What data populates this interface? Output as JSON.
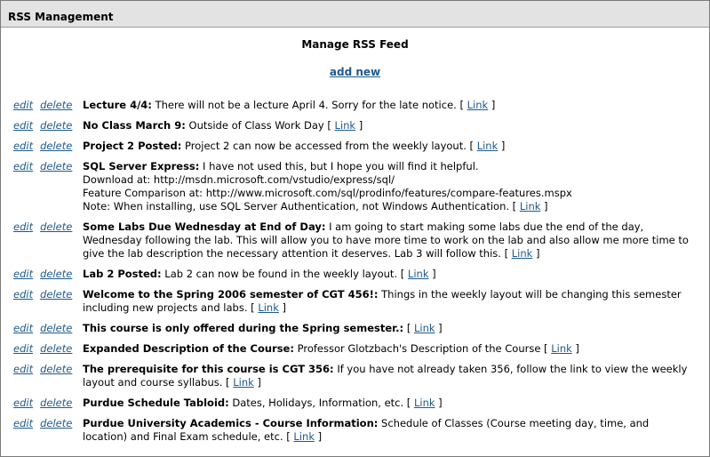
{
  "header": {
    "title": "RSS Management"
  },
  "page": {
    "heading": "Manage RSS Feed",
    "add_new_label": "add new"
  },
  "row_actions": {
    "edit_label": "edit",
    "delete_label": "delete"
  },
  "link_label": "Link",
  "feeds": [
    {
      "title": "Lecture 4/4:",
      "desc": "There will not be a lecture April 4. Sorry for the late notice.",
      "extra": []
    },
    {
      "title": "No Class March 9:",
      "desc": "Outside of Class Work Day",
      "extra": []
    },
    {
      "title": "Project 2 Posted:",
      "desc": "Project 2 can now be accessed from the weekly layout.",
      "extra": []
    },
    {
      "title": "SQL Server Express:",
      "desc": "I have not used this, but I hope you will find it helpful.",
      "extra": [
        "Download at: http://msdn.microsoft.com/vstudio/express/sql/",
        "Feature Comparison at: http://www.microsoft.com/sql/prodinfo/features/compare-features.mspx",
        "Note: When installing, use SQL Server Authentication, not Windows Authentication."
      ]
    },
    {
      "title": "Some Labs Due Wednesday at End of Day:",
      "desc": "I am going to start making some labs due the end of the day, Wednesday following the lab. This will allow you to have more time to work on the lab and also allow me more time to give the lab description the necessary attention it deserves. Lab 3 will follow this.",
      "extra": []
    },
    {
      "title": "Lab 2 Posted:",
      "desc": "Lab 2 can now be found in the weekly layout.",
      "extra": []
    },
    {
      "title": "Welcome to the Spring 2006 semester of CGT 456!:",
      "desc": "Things in the weekly layout will be changing this semester including new projects and labs.",
      "extra": []
    },
    {
      "title": "This course is only offered during the Spring semester.:",
      "desc": "",
      "extra": []
    },
    {
      "title": "Expanded Description of the Course:",
      "desc": "Professor Glotzbach's Description of the Course",
      "extra": []
    },
    {
      "title": "The prerequisite for this course is CGT 356:",
      "desc": "If you have not already taken 356, follow the link to view the weekly layout and course syllabus.",
      "extra": []
    },
    {
      "title": "Purdue Schedule Tabloid:",
      "desc": "Dates, Holidays, Information, etc.",
      "extra": []
    },
    {
      "title": "Purdue University Academics - Course Information:",
      "desc": "Schedule of Classes (Course meeting day, time, and location) and Final Exam schedule, etc.",
      "extra": []
    }
  ]
}
